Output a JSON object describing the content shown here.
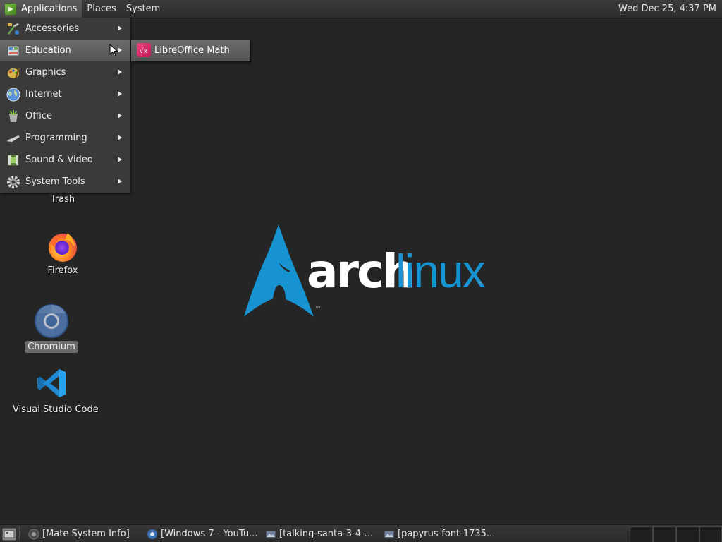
{
  "top_panel": {
    "applications_label": "Applications",
    "places_label": "Places",
    "system_label": "System",
    "clock": "Wed Dec 25,  4:37 PM"
  },
  "app_menu": {
    "items": [
      {
        "label": "Accessories",
        "icon": "accessories-icon"
      },
      {
        "label": "Education",
        "icon": "education-icon"
      },
      {
        "label": "Graphics",
        "icon": "graphics-icon"
      },
      {
        "label": "Internet",
        "icon": "internet-icon"
      },
      {
        "label": "Office",
        "icon": "office-icon"
      },
      {
        "label": "Programming",
        "icon": "programming-icon"
      },
      {
        "label": "Sound & Video",
        "icon": "sound-video-icon"
      },
      {
        "label": "System Tools",
        "icon": "system-tools-icon"
      }
    ],
    "hovered": "Education"
  },
  "submenu": {
    "items": [
      {
        "label": "LibreOffice Math",
        "icon": "libreoffice-math-icon"
      }
    ]
  },
  "desktop_icons": [
    {
      "label": "Trash",
      "icon": "trash-icon"
    },
    {
      "label": "Firefox",
      "icon": "firefox-icon"
    },
    {
      "label": "Chromium",
      "icon": "chromium-icon",
      "selected": true
    },
    {
      "label": "Visual Studio Code",
      "icon": "vscode-icon"
    }
  ],
  "wallpaper": {
    "logo_word1": "arch",
    "logo_word2": "linux",
    "tm": "™",
    "colors": {
      "blue": "#1793d1",
      "white": "#ffffff"
    }
  },
  "taskbar": {
    "tasks": [
      {
        "label": "[Mate System Info]",
        "icon": "system-info-icon"
      },
      {
        "label": "[Windows 7 - YouTu...",
        "icon": "chromium-icon"
      },
      {
        "label": "[talking-santa-3-4-...",
        "icon": "image-viewer-icon"
      },
      {
        "label": "[papyrus-font-1735...",
        "icon": "image-viewer-icon"
      }
    ]
  },
  "colors": {
    "desktop_bg": "#252525",
    "panel_bg": "#333333",
    "menu_bg": "#3a3a3a",
    "highlight": "#5e5e5e"
  }
}
